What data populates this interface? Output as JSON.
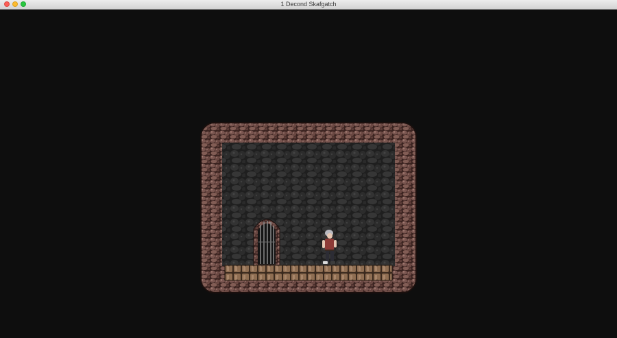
{
  "window": {
    "title": "1 Decond Skafgatch",
    "close_icon": "close-icon",
    "minimize_icon": "minimize-icon",
    "maximize_icon": "zoom-icon"
  },
  "colors": {
    "background": "#0e0e0e",
    "stone_brick": "#6f4c46",
    "stone_brick_light": "#8f6a62",
    "back_wall": "#2b2b2b",
    "wooden_floor": "#9b7a5e",
    "door_bars": "#7a7a7a",
    "player_shirt": "#8e3b37"
  },
  "scene": {
    "room": "stone-room",
    "door": "barred-door-icon",
    "player": "player-character-icon"
  }
}
